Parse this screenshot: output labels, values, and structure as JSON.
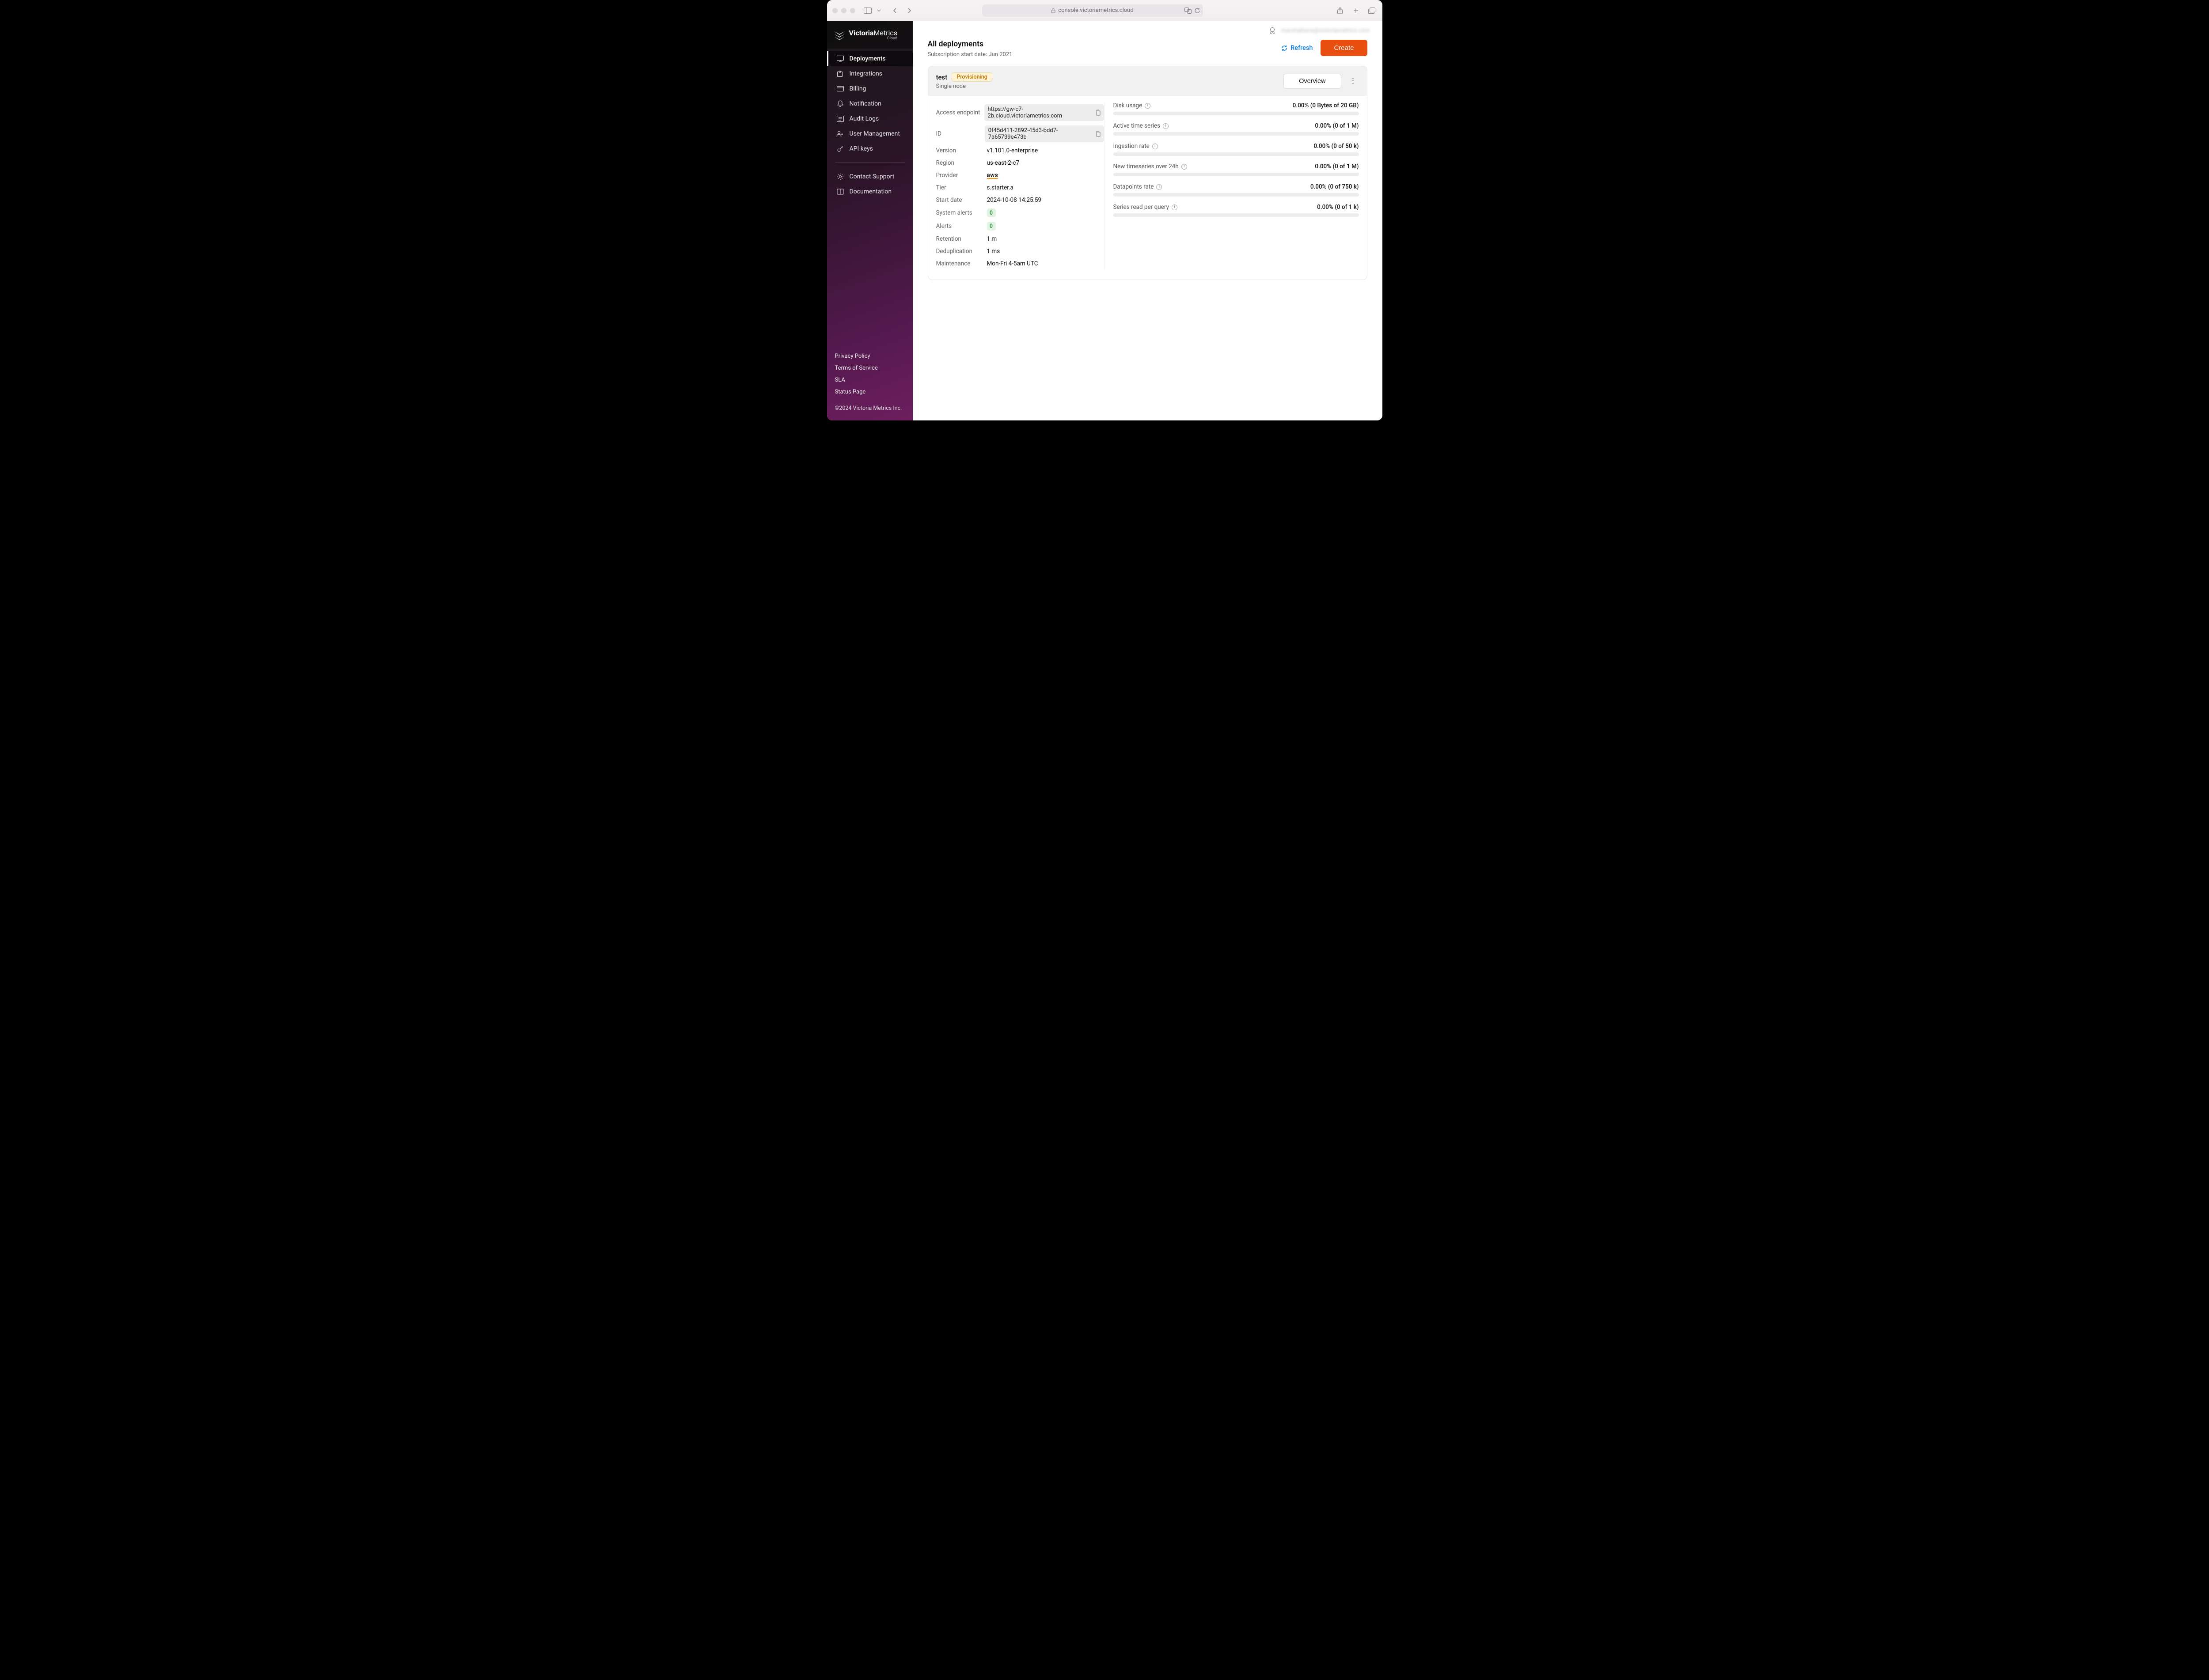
{
  "browser": {
    "url": "console.victoriametrics.cloud"
  },
  "brand": {
    "name_bold": "Victoria",
    "name_rest": "Metrics",
    "sub": "Cloud"
  },
  "nav": {
    "items": [
      {
        "label": "Deployments",
        "icon": "monitor-icon",
        "active": true
      },
      {
        "label": "Integrations",
        "icon": "puzzle-icon"
      },
      {
        "label": "Billing",
        "icon": "card-icon"
      },
      {
        "label": "Notification",
        "icon": "bell-icon"
      },
      {
        "label": "Audit Logs",
        "icon": "log-icon"
      },
      {
        "label": "User Management",
        "icon": "users-icon"
      },
      {
        "label": "API keys",
        "icon": "key-icon"
      }
    ],
    "support": [
      {
        "label": "Contact Support",
        "icon": "gear-icon"
      },
      {
        "label": "Documentation",
        "icon": "book-icon"
      }
    ]
  },
  "footer": {
    "links": [
      "Privacy Policy",
      "Terms of Service",
      "SLA",
      "Status Page"
    ],
    "copyright": "©2024 Victoria Metrics Inc."
  },
  "topbar": {
    "user_email": "marshalbeva@victoriametrics.com"
  },
  "page": {
    "title": "All deployments",
    "subscription_prefix": "Subscription start date: ",
    "subscription_date": "Jun 2021",
    "refresh_label": "Refresh",
    "create_label": "Create"
  },
  "deployment": {
    "name": "test",
    "status": "Provisioning",
    "mode": "Single node",
    "overview_label": "Overview",
    "details": {
      "access_endpoint_label": "Access endpoint",
      "access_endpoint": "https://gw-c7-2b.cloud.victoriametrics.com",
      "id_label": "ID",
      "id": "0f45d411-2892-45d3-bdd7-7a65739e473b",
      "version_label": "Version",
      "version": "v1.101.0-enterprise",
      "region_label": "Region",
      "region": "us-east-2-c7",
      "provider_label": "Provider",
      "provider": "aws",
      "tier_label": "Tier",
      "tier": "s.starter.a",
      "start_date_label": "Start date",
      "start_date": "2024-10-08 14:25:59",
      "system_alerts_label": "System alerts",
      "system_alerts": "0",
      "alerts_label": "Alerts",
      "alerts": "0",
      "retention_label": "Retention",
      "retention": "1 m",
      "dedup_label": "Deduplication",
      "dedup": "1 ms",
      "maintenance_label": "Maintenance",
      "maintenance": "Mon-Fri 4-5am UTC"
    },
    "metrics": [
      {
        "label": "Disk usage",
        "value": "0.00% (0 Bytes of 20 GB)"
      },
      {
        "label": "Active time series",
        "value": "0.00% (0 of 1 M)"
      },
      {
        "label": "Ingestion rate",
        "value": "0.00% (0 of 50 k)"
      },
      {
        "label": "New timeseries over 24h",
        "value": "0.00% (0 of 1 M)"
      },
      {
        "label": "Datapoints rate",
        "value": "0.00% (0 of 750 k)"
      },
      {
        "label": "Series read per query",
        "value": "0.00% (0 of 1 k)"
      }
    ]
  }
}
